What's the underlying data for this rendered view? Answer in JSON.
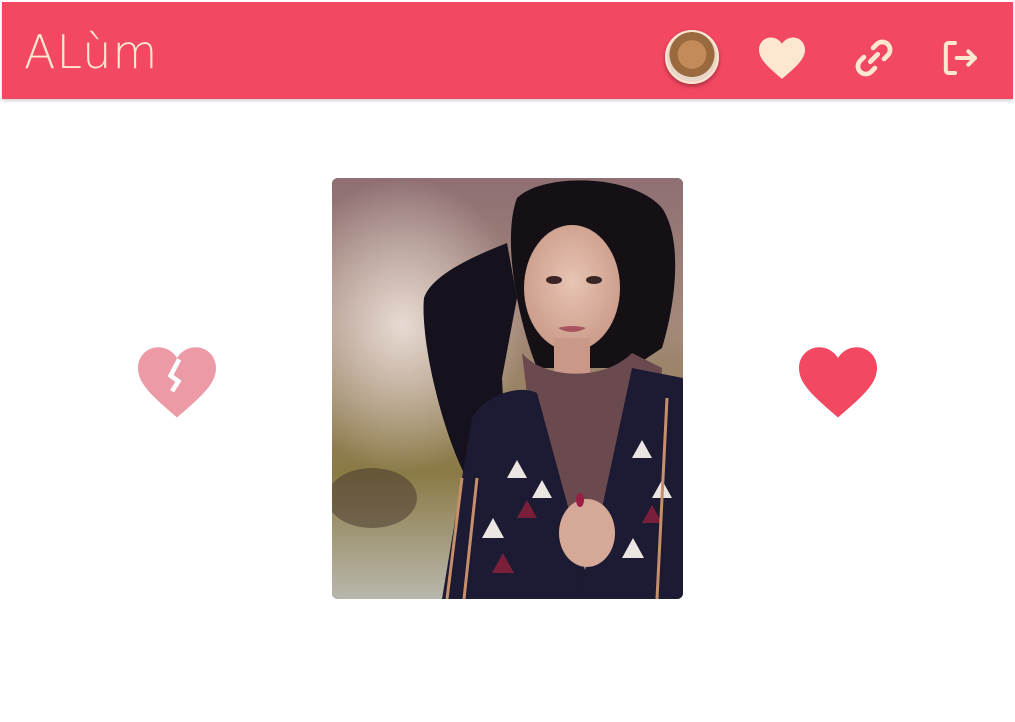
{
  "header": {
    "logo_text": "ALùm",
    "background_color": "#f34862",
    "icon_color": "#fde7d1",
    "avatar": {
      "icon": "user-avatar"
    },
    "actions": [
      {
        "icon": "heart-icon"
      },
      {
        "icon": "link-icon"
      },
      {
        "icon": "logout-icon"
      }
    ]
  },
  "main": {
    "profile_photo": {
      "icon": "profile-photo"
    },
    "dislike_button": {
      "icon": "broken-heart-icon",
      "color": "#ec9aa6"
    },
    "like_button": {
      "icon": "heart-icon",
      "color": "#f34862"
    }
  }
}
